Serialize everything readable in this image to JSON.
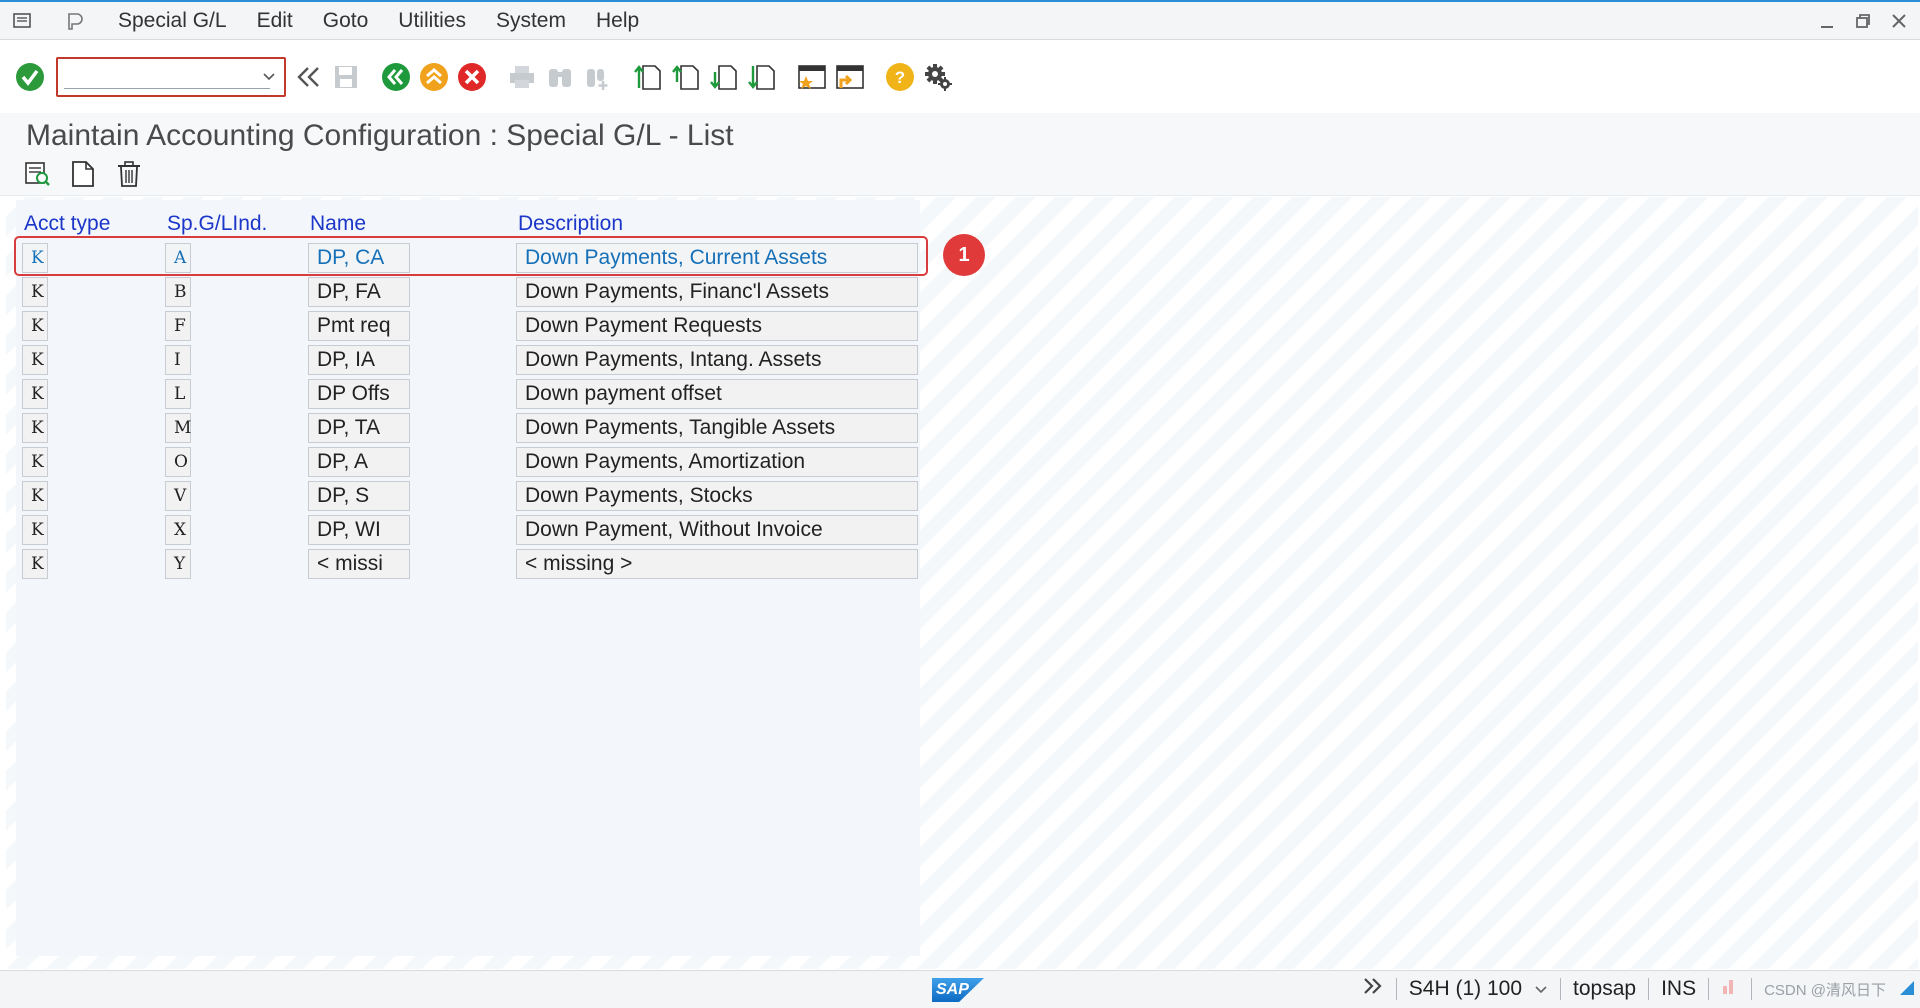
{
  "menu": {
    "items": [
      "Special G/L",
      "Edit",
      "Goto",
      "Utilities",
      "System",
      "Help"
    ]
  },
  "toolbar": {
    "command_value": ""
  },
  "page": {
    "title": "Maintain Accounting Configuration : Special G/L - List"
  },
  "table": {
    "headers": {
      "acct_type": "Acct type",
      "sp_gl_ind": "Sp.G/LInd.",
      "name": "Name",
      "description": "Description"
    },
    "rows": [
      {
        "acct_type": "K",
        "sp_gl_ind": "A",
        "name": "DP, CA",
        "description": "Down Payments, Current Assets"
      },
      {
        "acct_type": "K",
        "sp_gl_ind": "B",
        "name": "DP, FA",
        "description": "Down Payments, Financ'l Assets"
      },
      {
        "acct_type": "K",
        "sp_gl_ind": "F",
        "name": "Pmt req",
        "description": "Down Payment Requests"
      },
      {
        "acct_type": "K",
        "sp_gl_ind": "I",
        "name": "DP, IA",
        "description": "Down Payments, Intang. Assets"
      },
      {
        "acct_type": "K",
        "sp_gl_ind": "L",
        "name": "DP Offs",
        "description": "Down payment offset"
      },
      {
        "acct_type": "K",
        "sp_gl_ind": "M",
        "name": "DP, TA",
        "description": "Down Payments, Tangible Assets"
      },
      {
        "acct_type": "K",
        "sp_gl_ind": "O",
        "name": "DP, A",
        "description": "Down Payments, Amortization"
      },
      {
        "acct_type": "K",
        "sp_gl_ind": "V",
        "name": "DP, S",
        "description": "Down Payments, Stocks"
      },
      {
        "acct_type": "K",
        "sp_gl_ind": "X",
        "name": "DP, WI",
        "description": "Down Payment, Without Invoice"
      },
      {
        "acct_type": "K",
        "sp_gl_ind": "Y",
        "name": "< missi",
        "description": "< missing >"
      }
    ]
  },
  "annotation": {
    "badge": "1"
  },
  "status": {
    "system": "S4H (1) 100",
    "user": "topsap",
    "mode": "INS",
    "watermark": "CSDN @清风日下",
    "logo": "SAP"
  }
}
